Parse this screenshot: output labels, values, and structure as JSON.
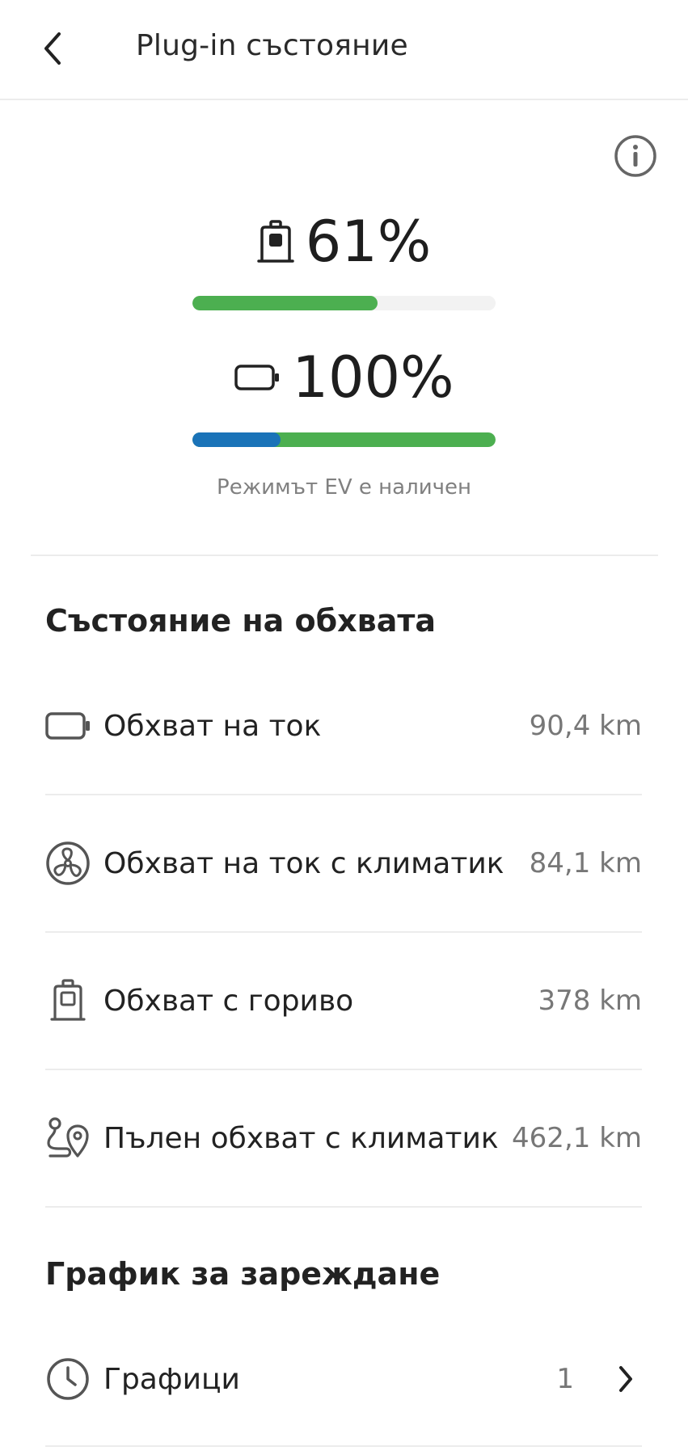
{
  "header": {
    "title": "Plug-in състояние",
    "back_icon": "chevron-left-icon"
  },
  "info_icon": "info-icon",
  "fuel_level": {
    "icon": "fuel-pump-icon",
    "value": "61%",
    "fraction": 0.61,
    "bar_color": "#4caf50"
  },
  "battery_level": {
    "icon": "battery-icon",
    "value": "100%",
    "ev_fraction": 0.29,
    "ev_color": "#1a73b8",
    "bar_color": "#4caf50"
  },
  "ev_status": "Режимът EV е наличен",
  "range_section": {
    "title": "Състояние на обхвата",
    "items": [
      {
        "icon": "battery-icon",
        "label": "Обхват на ток",
        "value": "90,4 km"
      },
      {
        "icon": "fan-icon",
        "label": "Обхват на ток с климатик",
        "value": "84,1 km"
      },
      {
        "icon": "fuel-pump-icon",
        "label": "Обхват с гориво",
        "value": "378 km"
      },
      {
        "icon": "route-pin-icon",
        "label": "Пълен обхват с климатик",
        "value": "462,1 km"
      }
    ]
  },
  "charging_section": {
    "title": "График за зареждане",
    "schedules": {
      "icon": "clock-icon",
      "label": "Графици",
      "count": "1",
      "chevron": "chevron-right-icon"
    }
  }
}
